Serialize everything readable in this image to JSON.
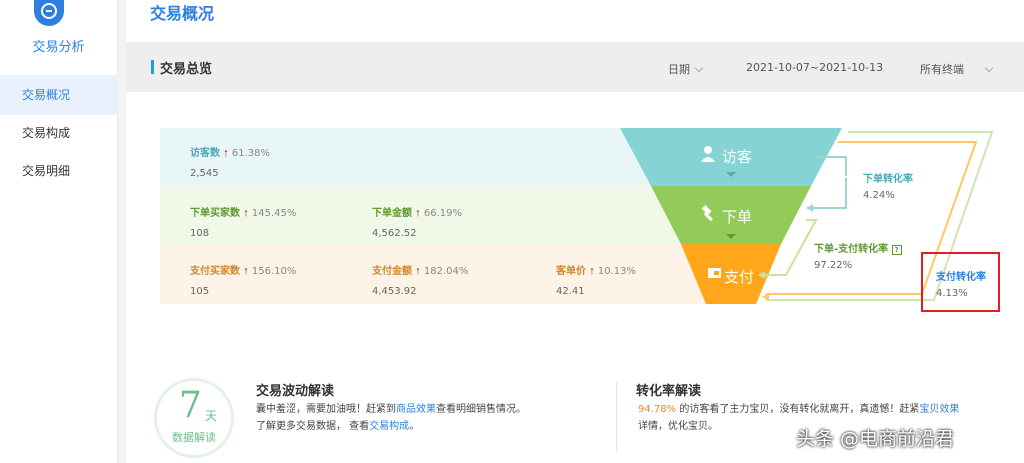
{
  "sidebar": {
    "title": "交易分析",
    "items": [
      {
        "label": "交易概况"
      },
      {
        "label": "交易构成"
      },
      {
        "label": "交易明细"
      }
    ]
  },
  "header": {
    "title": "交易概况"
  },
  "section": {
    "title": "交易总览",
    "date_label": "日期",
    "date_range": "2021-10-07~2021-10-13",
    "terminal": "所有终端"
  },
  "funnel": {
    "visitors": {
      "label": "访客数",
      "pct": "61.38%",
      "value": "2,545"
    },
    "order_buyers": {
      "label": "下单买家数",
      "pct": "145.45%",
      "value": "108"
    },
    "order_amount": {
      "label": "下单金额",
      "pct": "66.19%",
      "value": "4,562.52"
    },
    "pay_buyers": {
      "label": "支付买家数",
      "pct": "156.10%",
      "value": "105"
    },
    "pay_amount": {
      "label": "支付金额",
      "pct": "182.04%",
      "value": "4,453.92"
    },
    "unit_price": {
      "label": "客单价",
      "pct": "10.13%",
      "value": "42.41"
    },
    "stages": [
      "访客",
      "下单",
      "支付"
    ],
    "colors": {
      "visit": "#86d3d6",
      "order": "#93cb5a",
      "pay": "#ffa61a"
    }
  },
  "rates": {
    "order_rate": {
      "name": "下单转化率",
      "value": "4.24%"
    },
    "order_pay_rate": {
      "name": "下单-支付转化率",
      "value": "97.22%"
    },
    "pay_rate": {
      "name": "支付转化率",
      "value": "4.13%"
    }
  },
  "badge": {
    "num": "7",
    "unit": "天",
    "sub": "数据解读"
  },
  "card_fluct": {
    "title": "交易波动解读",
    "l1a": "囊中羞涩，需要加油哦！赶紧到",
    "l1link": "商品效果",
    "l1b": "查看明细销售情况。",
    "l2a": "了解更多交易数据，  查看",
    "l2link": "交易构成",
    "l2b": "。"
  },
  "card_conv": {
    "title": "转化率解读",
    "pct": "94.78%",
    "l1a": " 的访客看了主力宝贝，没有转化就离开，真遗憾！赶紧",
    "l1link": "宝贝效果",
    "l2": "详情，优化宝贝。"
  },
  "watermark": "头条 @电商前沿君"
}
